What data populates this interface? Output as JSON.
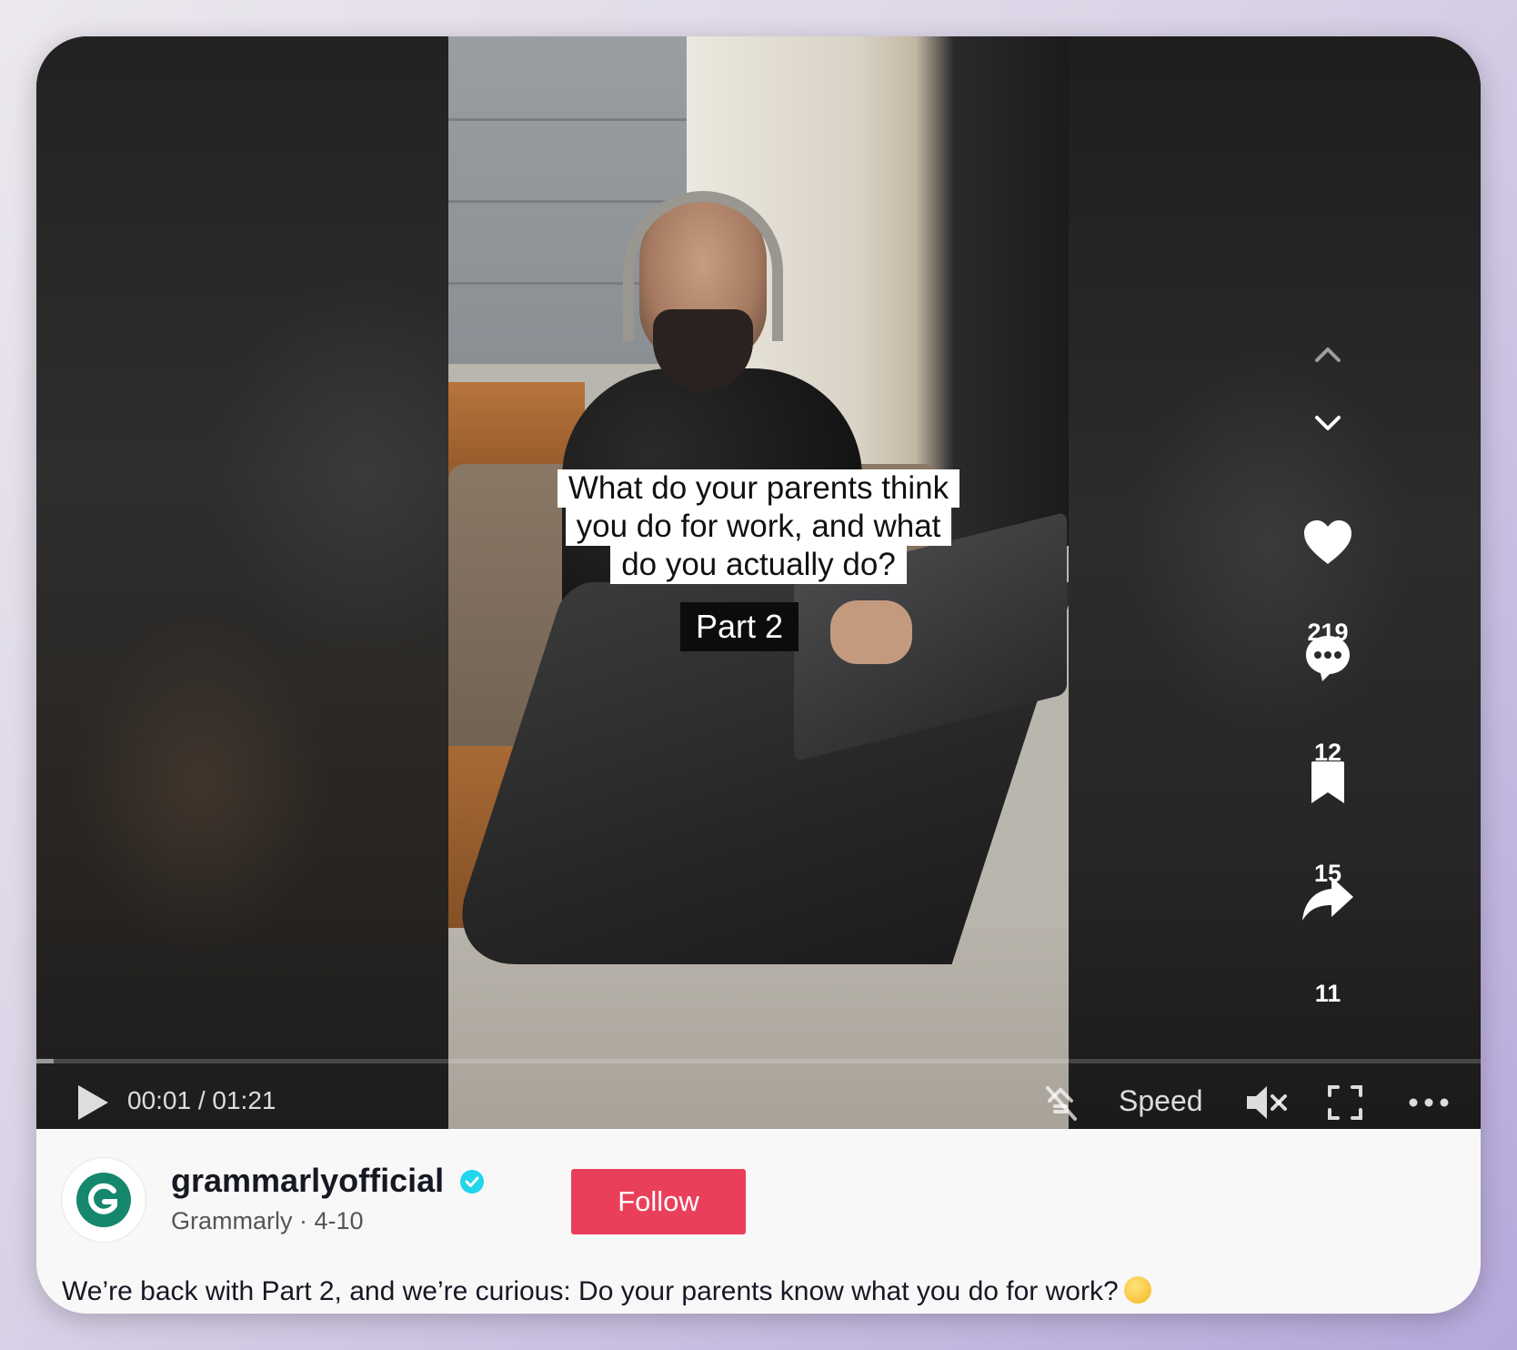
{
  "video": {
    "caption_lines": [
      "What do your parents think",
      "you do for work, and what",
      "do you actually do?"
    ],
    "part_label": "Part 2",
    "progress": 0.012
  },
  "actions": {
    "likes": "219",
    "comments": "12",
    "saves": "15",
    "shares": "11"
  },
  "controls": {
    "time": "00:01 / 01:21",
    "speed_label": "Speed"
  },
  "author": {
    "username": "grammarlyofficial",
    "display_name": "Grammarly",
    "date": "4-10",
    "separator": "·",
    "follow_label": "Follow",
    "avatar_letter": "G"
  },
  "description": "We’re back with Part 2, and we’re curious: Do your parents know what you do for work?",
  "colors": {
    "follow": "#ea3f5b",
    "verified": "#20d5ec",
    "grammarly": "#15876d"
  },
  "icons": [
    "chevron-up-icon",
    "chevron-down-icon",
    "heart-icon",
    "comment-icon",
    "bookmark-icon",
    "share-icon",
    "play-icon",
    "floating-player-icon",
    "mute-icon",
    "fullscreen-icon",
    "more-icon",
    "verified-icon",
    "thinking-face-emoji"
  ]
}
